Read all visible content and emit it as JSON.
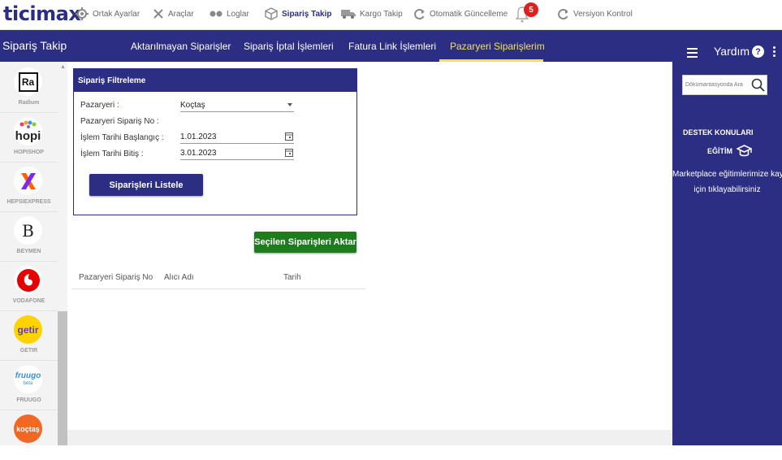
{
  "topbar": {
    "logo": "ticimax",
    "items": [
      {
        "label": "Ortak Ayarlar",
        "icon": "gear-icon"
      },
      {
        "label": "Araçlar",
        "icon": "tools-icon"
      },
      {
        "label": "Loglar",
        "icon": "glasses-icon"
      },
      {
        "label": "Sipariş Takip",
        "icon": "box-icon",
        "active": true
      },
      {
        "label": "Kargo Takip",
        "icon": "truck-icon"
      },
      {
        "label": "Otomatik Güncelleme",
        "icon": "refresh-icon"
      },
      {
        "label": "Versiyon Kontrol",
        "icon": "sync-icon"
      }
    ],
    "notification_count": "5"
  },
  "navbar": {
    "title": "Sipariş Takip",
    "tabs": [
      {
        "label": "Aktarılmayan Siparişler"
      },
      {
        "label": "Sipariş İptal İşlemleri"
      },
      {
        "label": "Fatura Link İşlemleri"
      },
      {
        "label": "Pazaryeri Siparişlerim",
        "active": true
      }
    ]
  },
  "sidebar": {
    "items": [
      {
        "label": "Radium",
        "logo": "Ra"
      },
      {
        "label": "HOPISHOP",
        "logo": "hopi"
      },
      {
        "label": "HEPSIEXPRESS",
        "logo": "X"
      },
      {
        "label": "BEYMEN",
        "logo": "B"
      },
      {
        "label": "VODAFONE",
        "logo": "vodafone"
      },
      {
        "label": "GETIR",
        "logo": "getir"
      },
      {
        "label": "FRUUGO",
        "logo": "fruugo",
        "sub": "beta"
      },
      {
        "label": "",
        "logo": "koçtaş"
      }
    ]
  },
  "filter": {
    "heading": "Sipariş Filtreleme",
    "marketplace_label": "Pazaryeri :",
    "marketplace_value": "Koçtaş",
    "order_no_label": "Pazaryeri Sipariş No :",
    "start_label": "İşlem Tarihi Başlangıç :",
    "start_value": "1.01.2023",
    "end_label": "İşlem Tarihi Bitiş :",
    "end_value": "3.01.2023",
    "list_button": "Siparişleri Listele"
  },
  "transfer_button": "Seçilen Siparişleri Aktar",
  "table": {
    "columns": [
      "Pazaryeri Sipariş No",
      "Alıcı Adı",
      "Tarih"
    ]
  },
  "help": {
    "title": "Yardım",
    "search_placeholder": "Dökümantasyonda Ara",
    "support_heading": "DESTEK KONULARI",
    "training": "EĞİTİM",
    "text_line1": "Marketplace eğitimlerimize kayıt",
    "text_line2": "için tıklayabilirsiniz"
  },
  "colors": {
    "brand": "#2b2e83",
    "active_tab": "#f2e24b",
    "transfer_button": "#1e7b1e",
    "badge": "#e02020"
  }
}
